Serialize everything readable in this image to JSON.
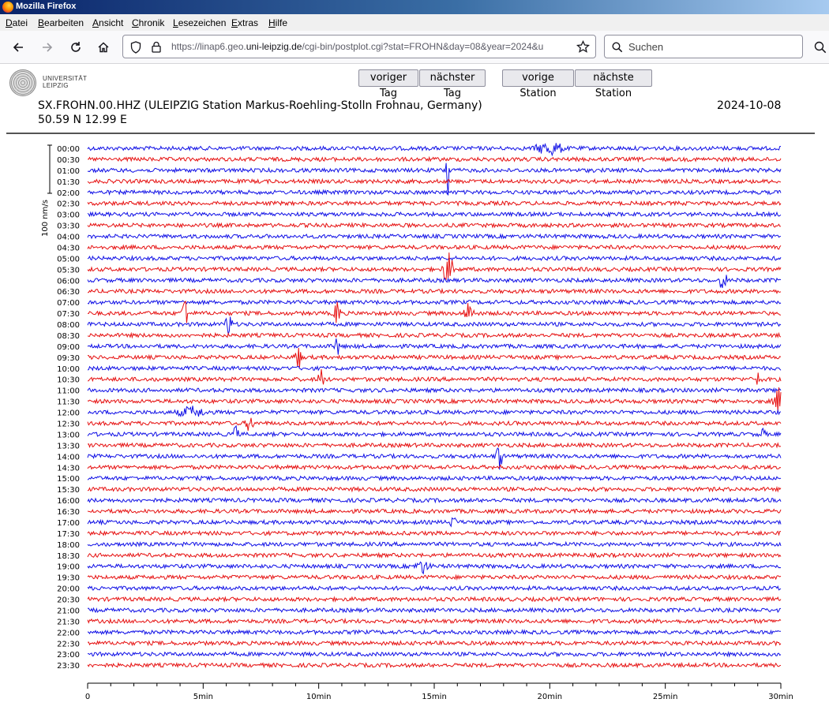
{
  "browser": {
    "window_title": "Mozilla Firefox",
    "menu": [
      "Datei",
      "Bearbeiten",
      "Ansicht",
      "Chronik",
      "Lesezeichen",
      "Extras",
      "Hilfe"
    ],
    "url_prefix": "https://linap6.geo.",
    "url_domain": "uni-leipzig.de",
    "url_path": "/cgi-bin/postplot.cgi?stat=FROHN&day=08&year=2024&u",
    "search_placeholder": "Suchen",
    "icons": [
      "back-icon",
      "forward-icon",
      "reload-icon",
      "home-icon",
      "shield-icon",
      "lock-icon",
      "bookmark-star-icon",
      "search-icon"
    ]
  },
  "page": {
    "logo_text_line1": "UNIVERSITÄT",
    "logo_text_line2": "LEIPZIG",
    "buttons": {
      "prev_day": "voriger Tag",
      "next_day": "nächster Tag",
      "prev_station": "vorige Station",
      "next_station": "nächste Station"
    },
    "station_title": "SX.FROHN.00.HHZ (ULEIPZIG Station Markus-Roehling-Stolln Frohnau, Germany)",
    "coordinates": "50.59 N 12.99 E",
    "date": "2024-10-08"
  },
  "chart_data": {
    "type": "line",
    "title": "",
    "scale_bar_label": "100 nm/s",
    "row_labels": [
      "00:00",
      "00:30",
      "01:00",
      "01:30",
      "02:00",
      "02:30",
      "03:00",
      "03:30",
      "04:00",
      "04:30",
      "05:00",
      "05:30",
      "06:00",
      "06:30",
      "07:00",
      "07:30",
      "08:00",
      "08:30",
      "09:00",
      "09:30",
      "10:00",
      "10:30",
      "11:00",
      "11:30",
      "12:00",
      "12:30",
      "13:00",
      "13:30",
      "14:00",
      "14:30",
      "15:00",
      "15:30",
      "16:00",
      "16:30",
      "17:00",
      "17:30",
      "18:00",
      "18:30",
      "19:00",
      "19:30",
      "20:00",
      "20:30",
      "21:00",
      "21:30",
      "22:00",
      "22:30",
      "23:00",
      "23:30"
    ],
    "x_ticks": [
      "0",
      "5min",
      "10min",
      "15min",
      "20min",
      "25min",
      "30min"
    ],
    "xlim_minutes": [
      0,
      30
    ],
    "series_colors": [
      "#1010e6",
      "#e61010"
    ],
    "events": [
      {
        "row": 0,
        "minute": 20.0,
        "amplitude": 1.6,
        "width_min": 0.8
      },
      {
        "row": 2,
        "minute": 15.6,
        "amplitude": 8.0,
        "width_min": 0.15
      },
      {
        "row": 11,
        "minute": 15.6,
        "amplitude": 4.0,
        "width_min": 0.3
      },
      {
        "row": 12,
        "minute": 27.5,
        "amplitude": 3.0,
        "width_min": 0.2
      },
      {
        "row": 15,
        "minute": 4.2,
        "amplitude": 6.0,
        "width_min": 0.15
      },
      {
        "row": 16,
        "minute": 6.1,
        "amplitude": 3.0,
        "width_min": 0.2
      },
      {
        "row": 15,
        "minute": 10.8,
        "amplitude": 5.0,
        "width_min": 0.15
      },
      {
        "row": 18,
        "minute": 10.8,
        "amplitude": 2.5,
        "width_min": 0.15
      },
      {
        "row": 15,
        "minute": 16.5,
        "amplitude": 2.5,
        "width_min": 0.3
      },
      {
        "row": 19,
        "minute": 9.1,
        "amplitude": 3.0,
        "width_min": 0.2
      },
      {
        "row": 21,
        "minute": 10.1,
        "amplitude": 3.2,
        "width_min": 0.15
      },
      {
        "row": 21,
        "minute": 29.0,
        "amplitude": 1.5,
        "width_min": 0.2
      },
      {
        "row": 23,
        "minute": 29.9,
        "amplitude": 3.0,
        "width_min": 0.3
      },
      {
        "row": 24,
        "minute": 4.5,
        "amplitude": 1.2,
        "width_min": 0.8
      },
      {
        "row": 25,
        "minute": 7.0,
        "amplitude": 2.5,
        "width_min": 0.2
      },
      {
        "row": 26,
        "minute": 6.4,
        "amplitude": 2.5,
        "width_min": 0.15
      },
      {
        "row": 26,
        "minute": 29.2,
        "amplitude": 1.2,
        "width_min": 0.2
      },
      {
        "row": 28,
        "minute": 17.8,
        "amplitude": 3.5,
        "width_min": 0.2
      },
      {
        "row": 34,
        "minute": 15.8,
        "amplitude": 1.0,
        "width_min": 0.3
      },
      {
        "row": 38,
        "minute": 14.5,
        "amplitude": 1.5,
        "width_min": 0.4
      }
    ]
  }
}
